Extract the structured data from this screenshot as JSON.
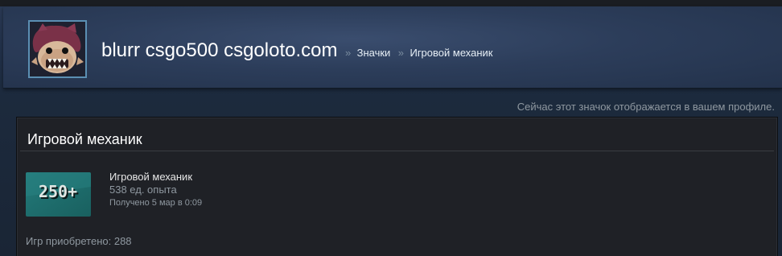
{
  "header": {
    "profile_name": "blurr csgo500 csgoloto.com",
    "separator": "»",
    "crumbs": [
      "Значки",
      "Игровой механик"
    ]
  },
  "notice": "Сейчас этот значок отображается в вашем профиле.",
  "badge": {
    "panel_title": "Игровой механик",
    "icon_text": "250+",
    "name": "Игровой механик",
    "xp": "538 ед. опыта",
    "unlocked": "Получено 5 мар в 0:09",
    "games_count": "Игр приобретено: 288"
  },
  "colors": {
    "background": "#1b2838",
    "panel": "#1f2126",
    "badge_teal": "#1f6f70",
    "muted_text": "#8f98a0"
  }
}
